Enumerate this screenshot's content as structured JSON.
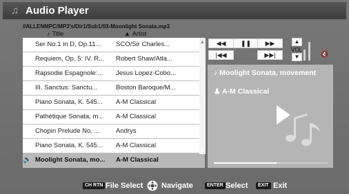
{
  "app": {
    "title": "Audio Player",
    "icon": "music-note-icon"
  },
  "path": "//ALLENMPC/MP3's/Dir1/Sub1/03-Moonlight Sonata.mp3",
  "columns": {
    "title": "Title",
    "artist": "Artist"
  },
  "tracks": [
    {
      "title": "Ser No.1 in D, Op.11...",
      "artist": "SCO/Sir Charles...",
      "playing": false
    },
    {
      "title": "Requiem, Op. 5: IV. R...",
      "artist": "Robert Shaw/Atla...",
      "playing": false
    },
    {
      "title": "Rapsodie Espagnole:...",
      "artist": "Jesus Lopez-Cobo...",
      "playing": false
    },
    {
      "title": "III. Sanctus: Sanctu...",
      "artist": "Boston Baroque/M...",
      "playing": false
    },
    {
      "title": "Piano Sonata, K. 545...",
      "artist": "A-M Classical",
      "playing": false
    },
    {
      "title": "Pathétique Sonata, m...",
      "artist": "A-M Classical",
      "playing": false
    },
    {
      "title": "Chopin Prelude No. ...",
      "artist": "Andrys",
      "playing": false
    },
    {
      "title": "Piano Sonata, K. 545...",
      "artist": "A-M Classical",
      "playing": false
    },
    {
      "title": "Moolight Sonata, mo...",
      "artist": "A-M Classical",
      "playing": true
    }
  ],
  "controls": {
    "rewind": "◀◀",
    "pause": "❚❚",
    "fast_forward": "▶▶",
    "prev": "|◀◀",
    "next": "▶▶|",
    "vol_up": "▲",
    "vol_down": "▼",
    "vol_label": "VOL",
    "mute": "🔇"
  },
  "volume_level": 0.75,
  "now_playing": {
    "title": "Moolight Sonata, movement",
    "artist": "A-M Classical",
    "progress": 0.55
  },
  "footer": [
    {
      "key": "CH RTN",
      "label": "File Select"
    },
    {
      "key": "",
      "label": "Navigate"
    },
    {
      "key": "ENTER",
      "label": "Select"
    },
    {
      "key": "EXIT",
      "label": "Exit"
    }
  ],
  "colors": {
    "panel": "#b5b5b5",
    "background": "#6b6b6b",
    "titlebar": "#444444"
  }
}
